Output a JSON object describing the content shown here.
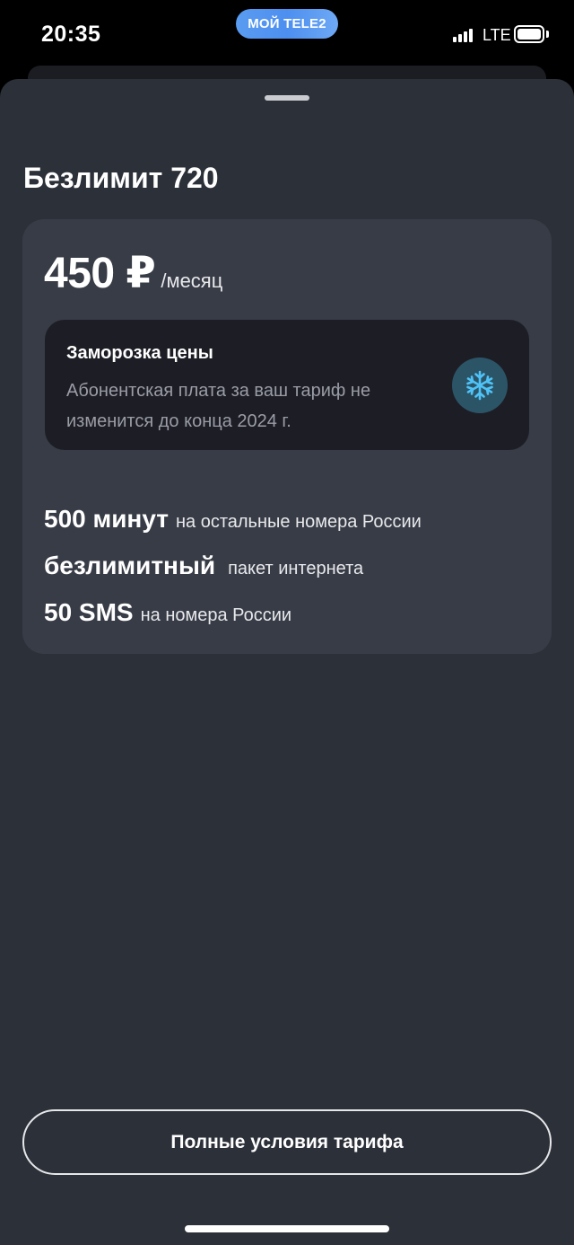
{
  "status_bar": {
    "time": "20:35",
    "app_pill": "МОЙ TELE2",
    "network": "LTE",
    "icons": [
      "signal-icon",
      "battery-icon"
    ]
  },
  "sheet": {
    "title": "Безлимит 720",
    "price": {
      "amount": "450 ₽",
      "period": "/месяц"
    },
    "freeze": {
      "title": "Заморозка цены",
      "description": "Абонентская плата за ваш тариф не изменится до конца 2024 г.",
      "icon": "snowflake-icon"
    },
    "features": [
      {
        "main": "500 минут",
        "sub": "на остальные номера России"
      },
      {
        "main": "безлимитный",
        "sub": "пакет интернета"
      },
      {
        "main": "50 SMS",
        "sub": "на номера России"
      }
    ],
    "full_terms_button": "Полные условия тарифа"
  },
  "colors": {
    "background": "#000000",
    "sheet": "#2c3038",
    "card": "#383c46",
    "freeze_box": "#1d1e25",
    "freeze_icon_bg": "#2c5467",
    "freeze_icon": "#4fc3f7",
    "app_pill": "#4d8ff0"
  }
}
